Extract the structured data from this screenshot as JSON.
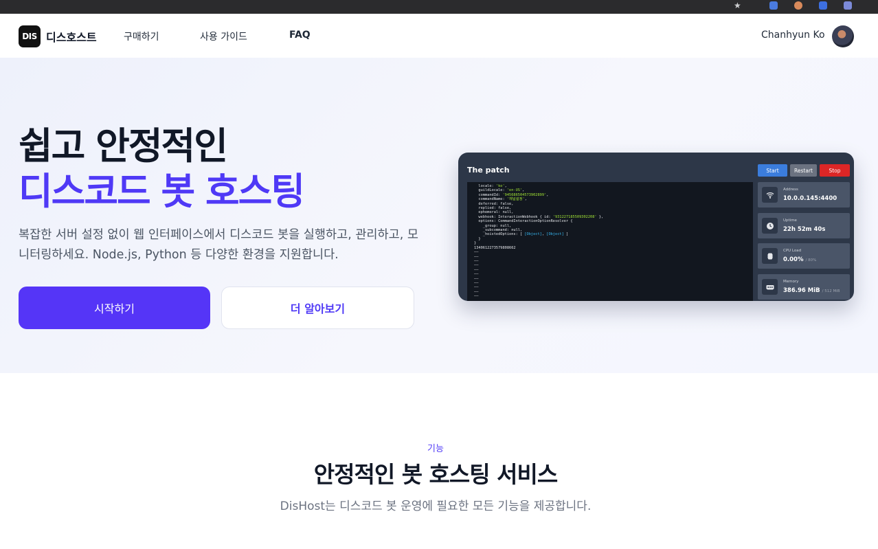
{
  "nav": {
    "logo_text": "DIS",
    "brand": "디스호스트",
    "links": [
      "구매하기",
      "사용 가이드",
      "FAQ"
    ],
    "user_name": "Chanhyun Ko"
  },
  "hero": {
    "title_line1": "쉽고 안정적인",
    "title_line2": "디스코드 봇 호스팅",
    "description": "복잡한 서버 설정 없이 웹 인터페이스에서 디스코드 봇을 실행하고, 관리하고, 모니터링하세요. Node.js, Python 등 다양한 환경을 지원합니다.",
    "primary_button": "시작하기",
    "secondary_button": "더 알아보기"
  },
  "console": {
    "title": "The patch",
    "buttons": {
      "start": "Start",
      "restart": "Restart",
      "stop": "Stop"
    },
    "log_lines": [
      "  locale: 'ko',",
      "  guildLocale: 'en-US',",
      "  commandId: '945686504573902899',",
      "  commandName: '채널설정',",
      "  deferred: false,",
      "  replied: false,",
      "  ephemeral: null,",
      "  webhook: InteractionWebhook { id: '931227185509302208' },",
      "  options: CommandInteractionOptionResolver {",
      "    _group: null,",
      "    _subcommand: null,",
      "    _hoistedOptions: [ [Object], [Object] ]",
      "  }",
      "}",
      "1340612273579808662",
      "——",
      "——",
      "——",
      "——",
      "——",
      "——",
      "——",
      "——",
      "——",
      "——",
      "——"
    ],
    "stats": {
      "address": {
        "label": "Address",
        "value": "10.0.0.145:4400"
      },
      "uptime": {
        "label": "Uptime",
        "value": "22h 52m 40s"
      },
      "cpu": {
        "label": "CPU Load",
        "value": "0.00%",
        "limit": "/ 80%"
      },
      "memory": {
        "label": "Memory",
        "value": "386.96 MiB",
        "limit": "/ 512 MiB"
      }
    }
  },
  "features": {
    "tag": "기능",
    "title": "안정적인 봇 호스팅 서비스",
    "description": "DisHost는 디스코드 봇 운영에 필요한 모든 기능을 제공합니다."
  },
  "colors": {
    "accent": "#4f39f6",
    "primary_button": "#5535f7",
    "console_bg": "#2d3748",
    "terminal_bg": "#12171f",
    "start": "#3b7ddd",
    "restart": "#6b7280",
    "stop": "#dc2626"
  }
}
